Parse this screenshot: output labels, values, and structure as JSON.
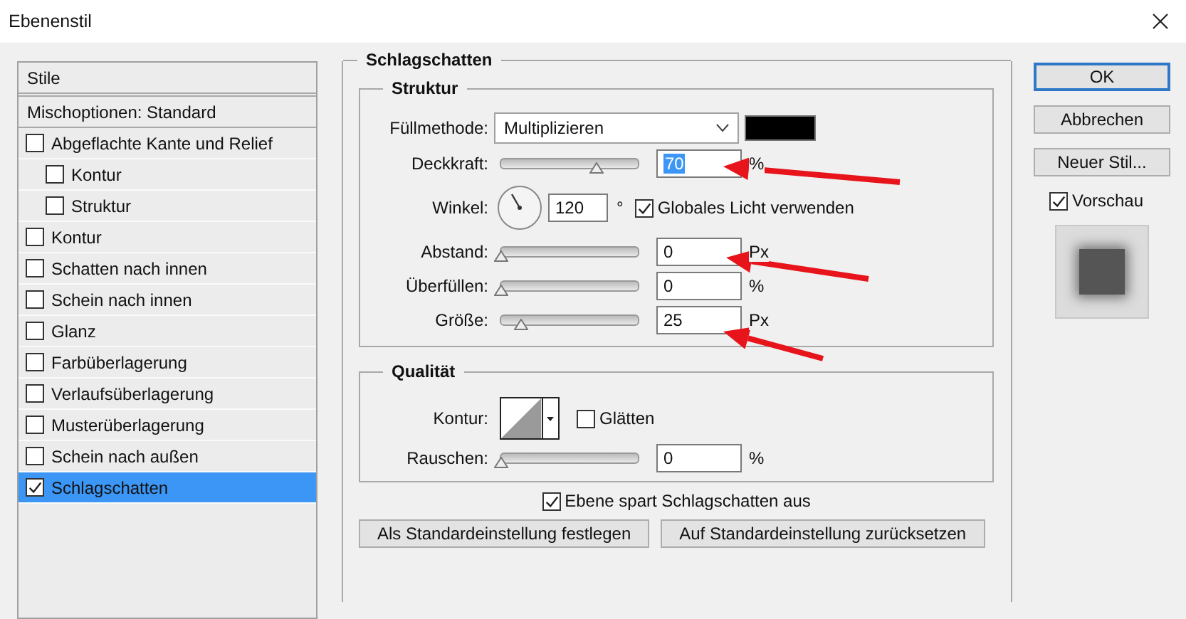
{
  "window": {
    "title": "Ebenenstil"
  },
  "styles_panel": {
    "header": "Stile",
    "blend_options": "Mischoptionen: Standard",
    "items": [
      {
        "label": "Abgeflachte Kante und Relief",
        "checked": false,
        "selected": false,
        "children": [
          {
            "label": "Kontur",
            "checked": false,
            "selected": false
          },
          {
            "label": "Struktur",
            "checked": false,
            "selected": false
          }
        ]
      },
      {
        "label": "Kontur",
        "checked": false,
        "selected": false
      },
      {
        "label": "Schatten nach innen",
        "checked": false,
        "selected": false
      },
      {
        "label": "Schein nach innen",
        "checked": false,
        "selected": false
      },
      {
        "label": "Glanz",
        "checked": false,
        "selected": false
      },
      {
        "label": "Farbüberlagerung",
        "checked": false,
        "selected": false
      },
      {
        "label": "Verlaufsüberlagerung",
        "checked": false,
        "selected": false
      },
      {
        "label": "Musterüberlagerung",
        "checked": false,
        "selected": false
      },
      {
        "label": "Schein nach außen",
        "checked": false,
        "selected": false
      },
      {
        "label": "Schlagschatten",
        "checked": true,
        "selected": true
      }
    ]
  },
  "effect": {
    "title": "Schlagschatten",
    "structure": {
      "title": "Struktur",
      "blend_mode": {
        "label": "Füllmethode:",
        "value": "Multiplizieren"
      },
      "rows": [
        {
          "kind": "slider",
          "label": "Deckkraft:",
          "level": 0.7,
          "value": "70",
          "unit": "%",
          "highlighted": true
        },
        {
          "kind": "angle",
          "label": "Winkel:",
          "value": "120",
          "unit": "°",
          "checkbox": {
            "label": "Globales Licht verwenden",
            "checked": true
          }
        },
        {
          "kind": "slider",
          "label": "Abstand:",
          "level": 0,
          "value": "0",
          "unit": "Px",
          "highlighted": false
        },
        {
          "kind": "slider",
          "label": "Überfüllen:",
          "level": 0,
          "value": "0",
          "unit": "%",
          "highlighted": false
        },
        {
          "kind": "slider",
          "label": "Größe:",
          "level": 0.15,
          "value": "25",
          "unit": "Px",
          "highlighted": false
        }
      ]
    },
    "quality": {
      "title": "Qualität",
      "contour_label": "Kontur:",
      "antialias": {
        "label": "Glätten",
        "checked": false
      },
      "noise": {
        "label": "Rauschen:",
        "level": 0,
        "value": "0",
        "unit": "%"
      }
    },
    "knockout": {
      "label": "Ebene spart Schlagschatten aus",
      "checked": true
    },
    "default_buttons": [
      "Als Standardeinstellung festlegen",
      "Auf Standardeinstellung zurücksetzen"
    ]
  },
  "side_buttons": [
    {
      "label": "OK",
      "default": true
    },
    {
      "label": "Abbrechen",
      "default": false
    },
    {
      "label": "Neuer Stil...",
      "default": false
    }
  ],
  "preview": {
    "label": "Vorschau",
    "checked": true
  }
}
